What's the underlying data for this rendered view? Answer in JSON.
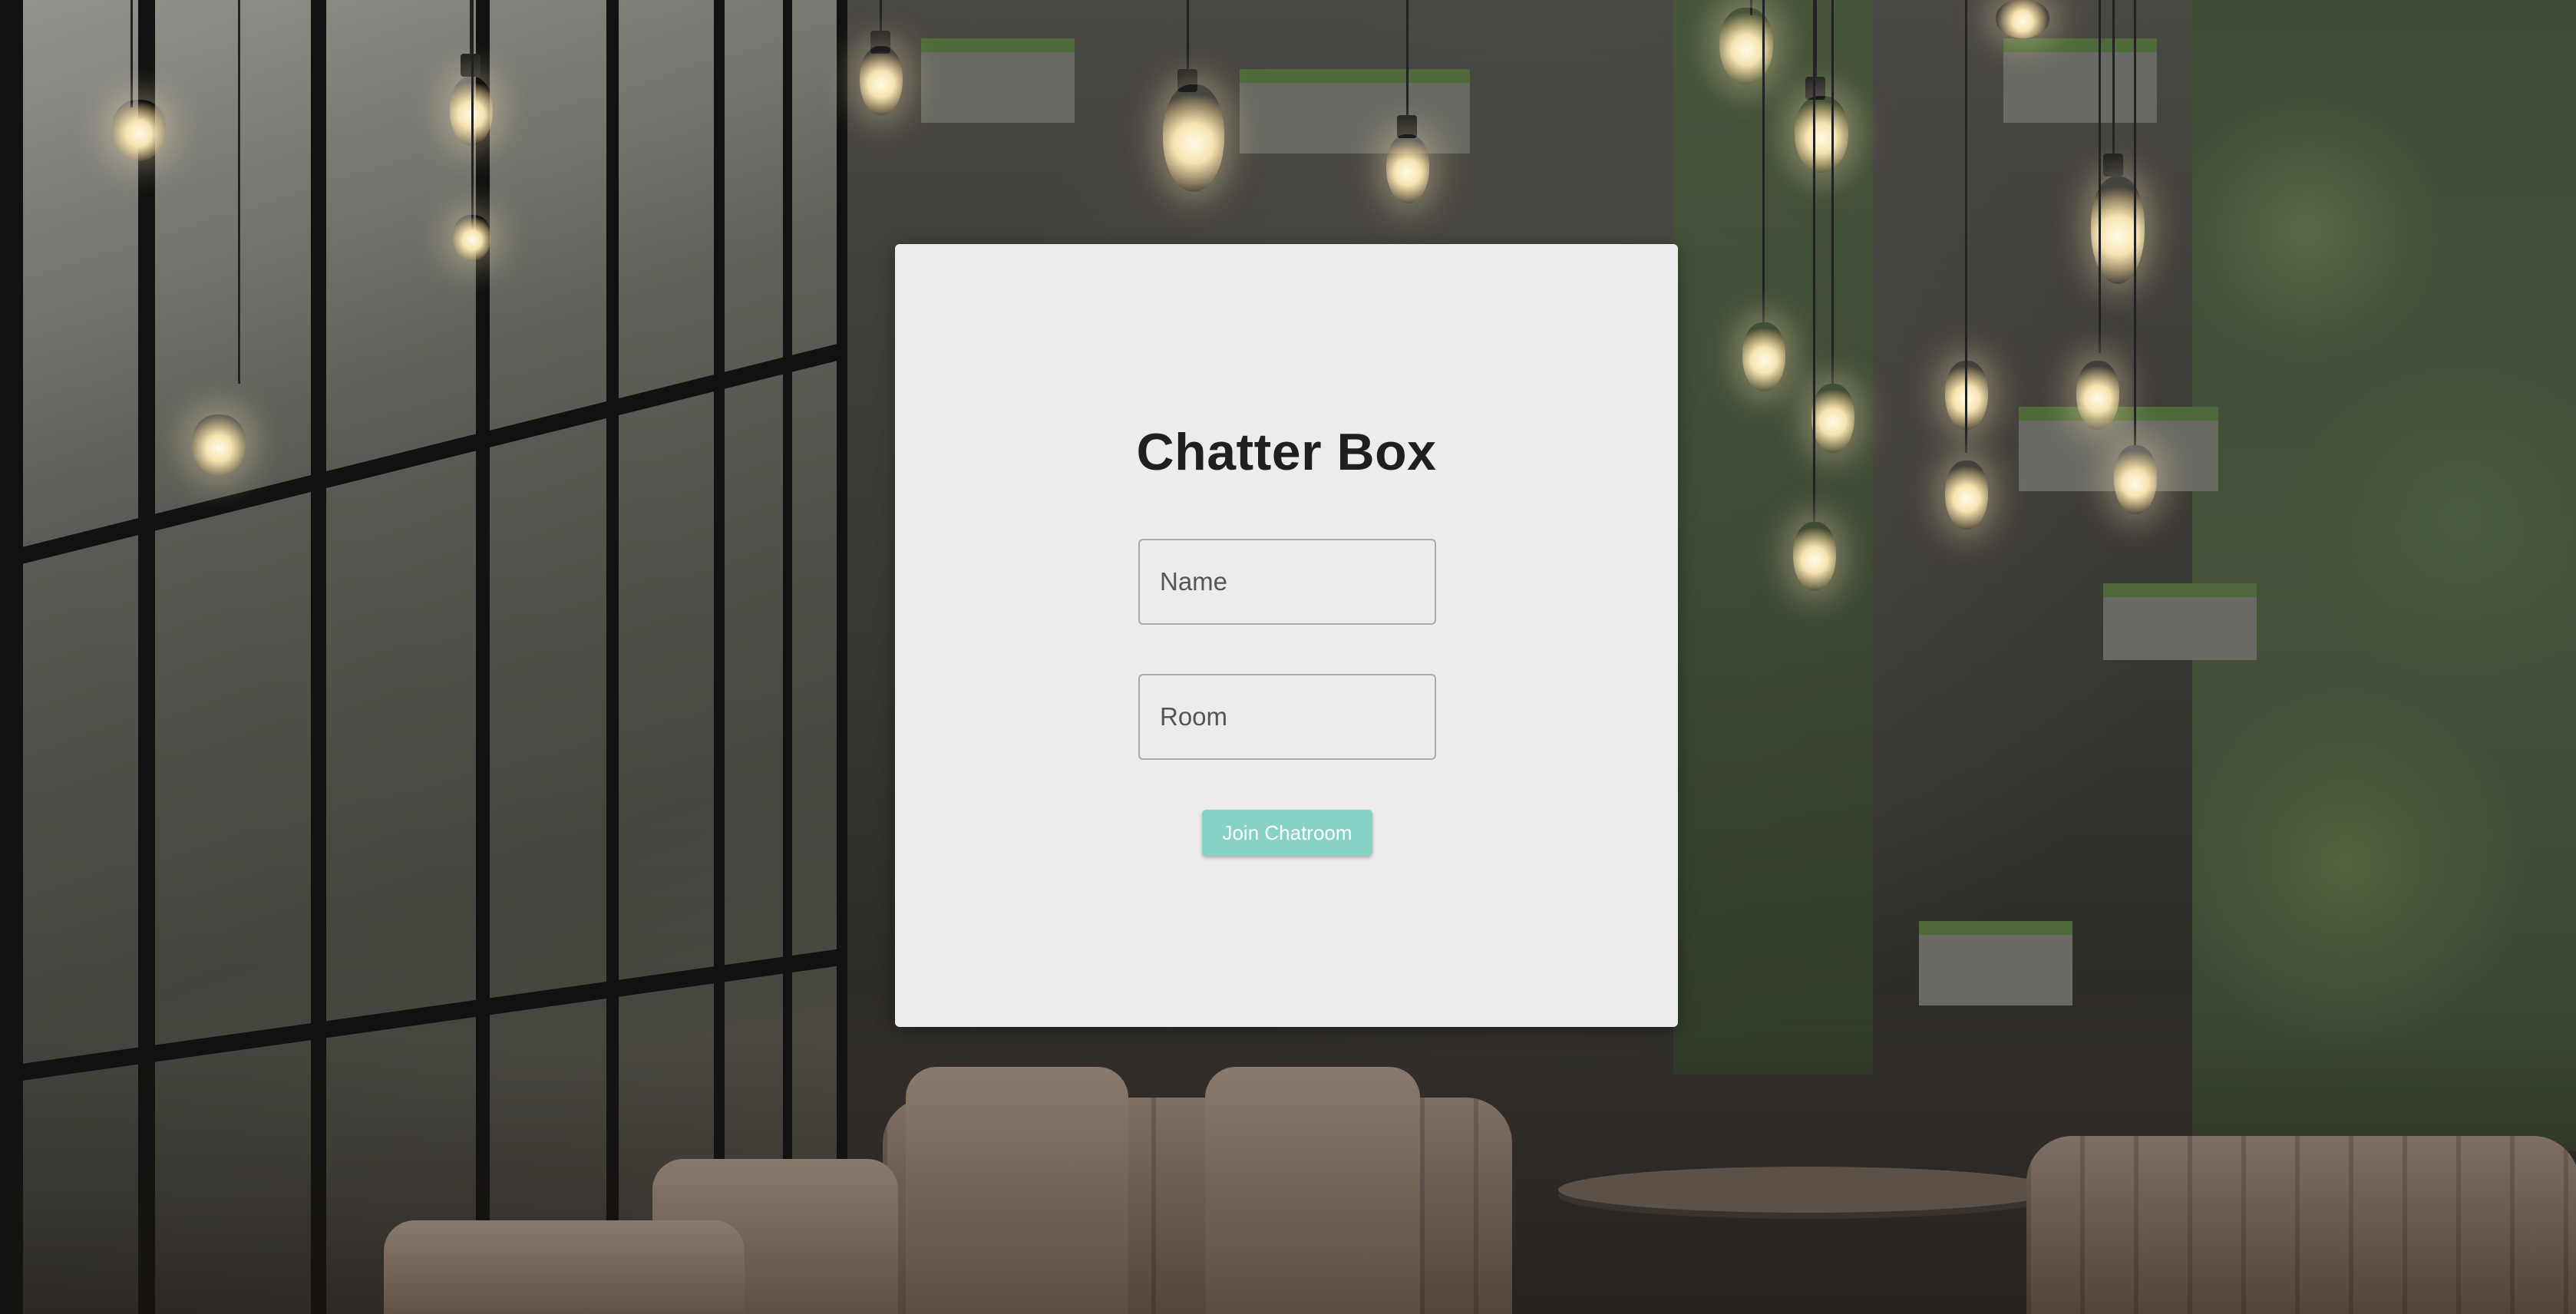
{
  "background": {
    "scene": "industrial-cafe-interior"
  },
  "card": {
    "title": "Chatter Box",
    "name_field": {
      "placeholder": "Name",
      "value": ""
    },
    "room_field": {
      "placeholder": "Room",
      "value": ""
    },
    "join_button_label": "Join Chatroom"
  },
  "colors": {
    "card_background": "#ececec",
    "title_text": "#1f1f1f",
    "button_background": "#86d3c6",
    "button_text": "#ffffff",
    "field_border": "#a9a9a9"
  }
}
